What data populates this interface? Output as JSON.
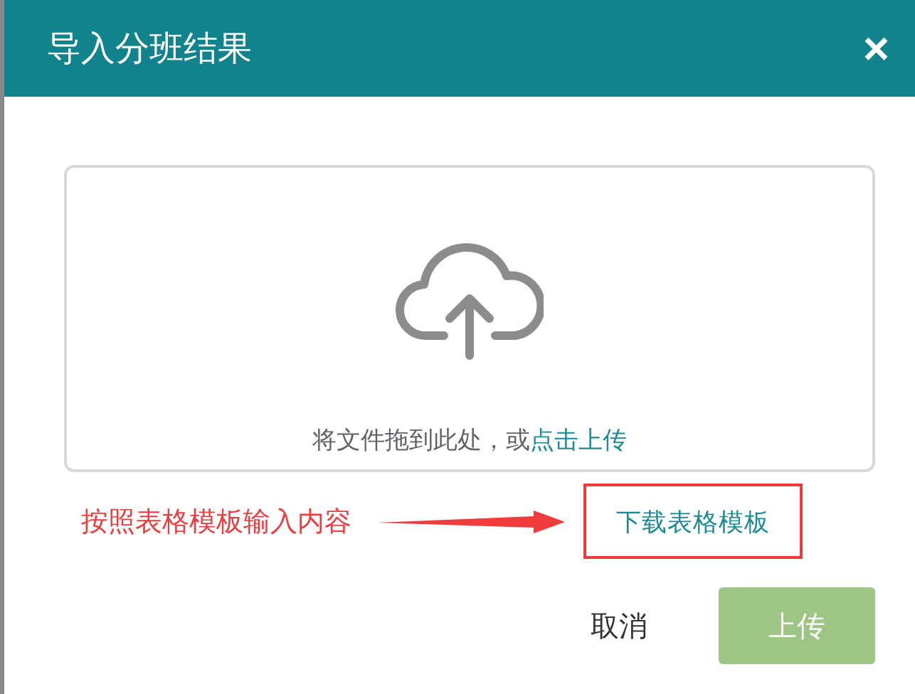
{
  "dialog": {
    "title": "导入分班结果",
    "close": "×"
  },
  "dropzone": {
    "hint": "将文件拖到此处，或",
    "link": "点击上传"
  },
  "annotation": {
    "note": "按照表格模板输入内容",
    "link": "下载表格模板"
  },
  "buttons": [
    {
      "kind": "text",
      "label": "取消",
      "disabled": false
    },
    {
      "kind": "primary",
      "label": "上传",
      "disabled": true
    }
  ]
}
